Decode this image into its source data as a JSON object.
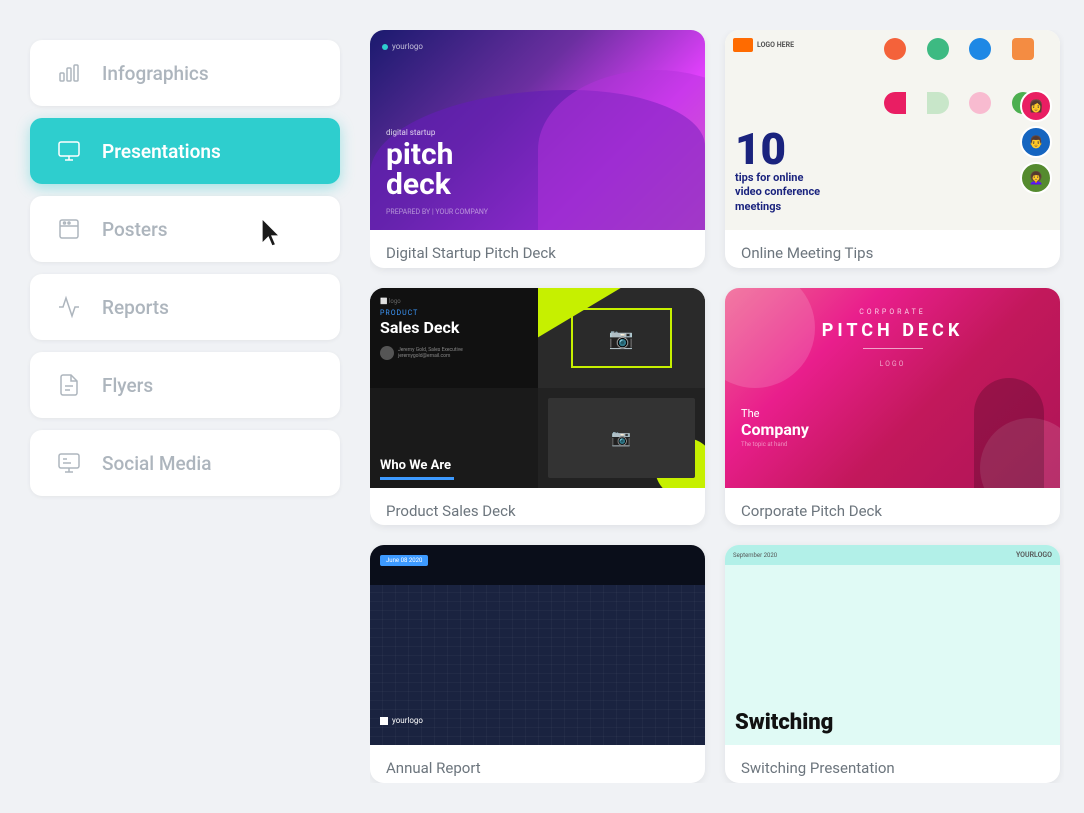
{
  "sidebar": {
    "items": [
      {
        "id": "infographics",
        "label": "Infographics",
        "icon": "bar-chart-icon",
        "active": false
      },
      {
        "id": "presentations",
        "label": "Presentations",
        "icon": "presentation-icon",
        "active": true
      },
      {
        "id": "posters",
        "label": "Posters",
        "icon": "poster-icon",
        "active": false
      },
      {
        "id": "reports",
        "label": "Reports",
        "icon": "reports-icon",
        "active": false
      },
      {
        "id": "flyers",
        "label": "Flyers",
        "icon": "flyers-icon",
        "active": false
      },
      {
        "id": "social-media",
        "label": "Social Media",
        "icon": "social-icon",
        "active": false
      }
    ]
  },
  "templates": {
    "cards": [
      {
        "id": "digital-startup",
        "label": "Digital Startup Pitch Deck"
      },
      {
        "id": "online-meeting",
        "label": "Online Meeting Tips"
      },
      {
        "id": "product-sales",
        "label": "Product Sales Deck"
      },
      {
        "id": "corporate-pitch",
        "label": "Corporate Pitch Deck"
      },
      {
        "id": "building-deck",
        "label": "Annual Report"
      },
      {
        "id": "switching-deck",
        "label": "Switching Presentation"
      }
    ]
  },
  "colors": {
    "active_bg": "#2ecece",
    "background": "#f0f2f5",
    "card_bg": "#ffffff"
  }
}
